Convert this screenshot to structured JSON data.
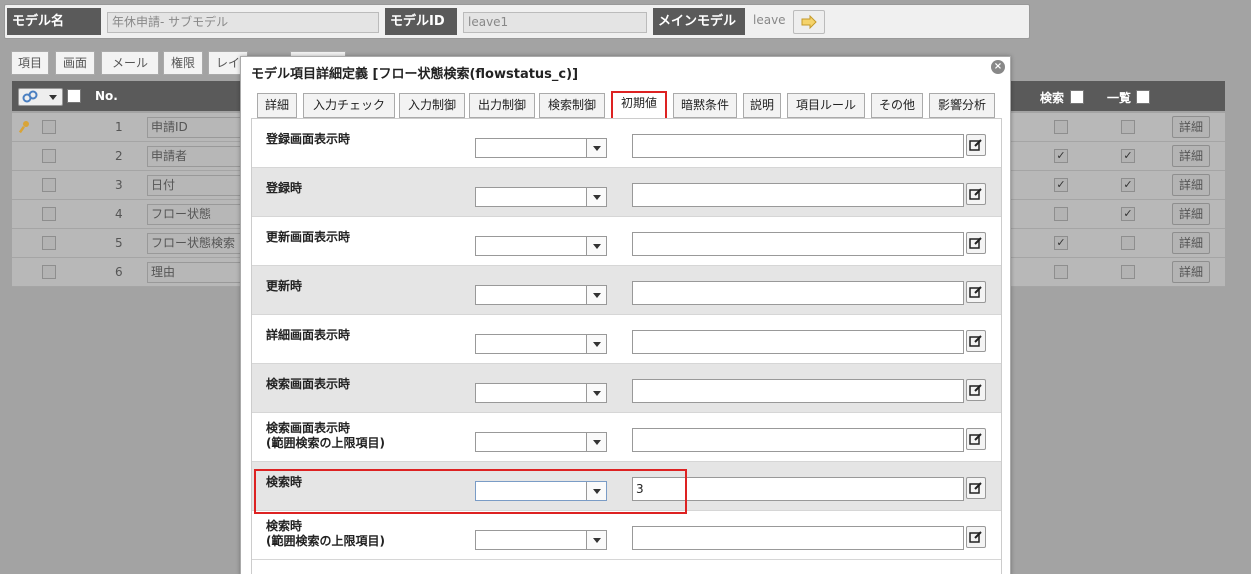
{
  "header": {
    "model_name_label": "モデル名",
    "model_name_value": "年休申請- サブモデル",
    "model_id_label": "モデルID",
    "model_id_value": "leave1",
    "main_model_label": "メインモデル",
    "main_model_value": "leave"
  },
  "bg_tabs": [
    "項目",
    "画面",
    "メール",
    "権限",
    "レイ"
  ],
  "bg_table": {
    "no_header": "No.",
    "search_header": "検索",
    "list_header": "一覧",
    "rows": [
      {
        "no": "1",
        "name": "申請ID",
        "search": false,
        "list": false,
        "detail": "詳細"
      },
      {
        "no": "2",
        "name": "申請者",
        "search": true,
        "list": true,
        "detail": "詳細"
      },
      {
        "no": "3",
        "name": "日付",
        "search": true,
        "list": true,
        "detail": "詳細"
      },
      {
        "no": "4",
        "name": "フロー状態",
        "search": false,
        "list": true,
        "detail": "詳細"
      },
      {
        "no": "5",
        "name": "フロー状態検索",
        "search": true,
        "list": false,
        "detail": "詳細"
      },
      {
        "no": "6",
        "name": "理由",
        "search": false,
        "list": false,
        "detail": "詳細"
      }
    ]
  },
  "modal": {
    "title": "モデル項目詳細定義 [フロー状態検索(flowstatus_c)]",
    "close": "×",
    "tabs": [
      "詳細",
      "入力チェック",
      "入力制御",
      "出力制御",
      "検索制御",
      "初期値",
      "暗黙条件",
      "説明",
      "項目ルール",
      "その他",
      "影響分析"
    ],
    "active_tab": "初期値",
    "fields": [
      {
        "label": "登録画面表示時",
        "value": ""
      },
      {
        "label": "登録時",
        "value": ""
      },
      {
        "label": "更新画面表示時",
        "value": ""
      },
      {
        "label": "更新時",
        "value": ""
      },
      {
        "label": "詳細画面表示時",
        "value": ""
      },
      {
        "label": "検索画面表示時",
        "value": ""
      },
      {
        "label": "検索画面表示時\n(範囲検索の上限項目)",
        "value": ""
      },
      {
        "label": "検索時",
        "value": "3"
      },
      {
        "label": "検索時\n(範囲検索の上限項目)",
        "value": ""
      }
    ]
  },
  "colors": {
    "highlight": "#dd2222",
    "header_dark": "#5a5a5a"
  }
}
